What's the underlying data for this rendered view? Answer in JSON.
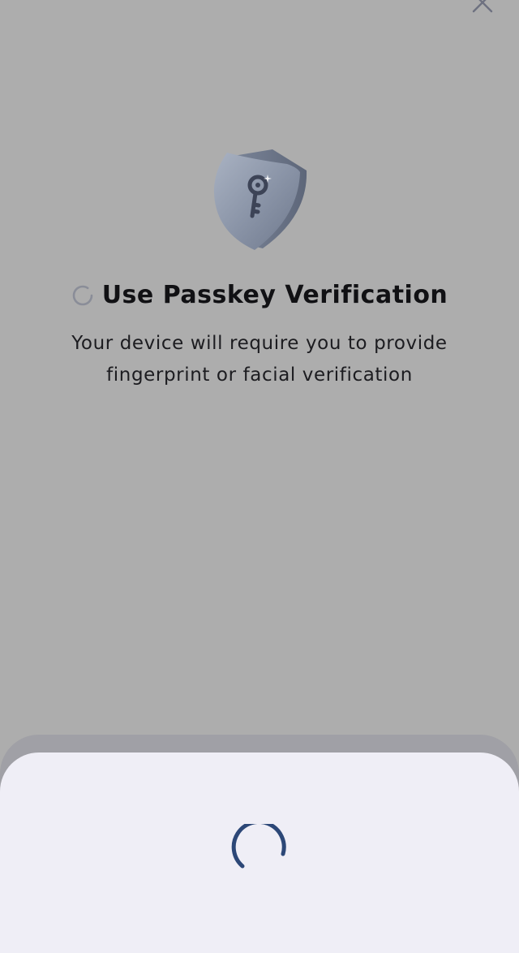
{
  "dialog": {
    "title": "Use Passkey Verification",
    "subtitle": "Your device will require you to provide fingerprint or facial verification",
    "close_icon": "close-icon",
    "hero_icon": "shield-key-icon",
    "loading_icon": "loading-spinner-icon"
  },
  "bottom_sheet": {
    "loading_icon": "loading-spinner-icon",
    "accent_color": "#2c4777"
  },
  "colors": {
    "overlay": "#adadad",
    "sheet": "#efeef6",
    "title_text": "#111114"
  }
}
